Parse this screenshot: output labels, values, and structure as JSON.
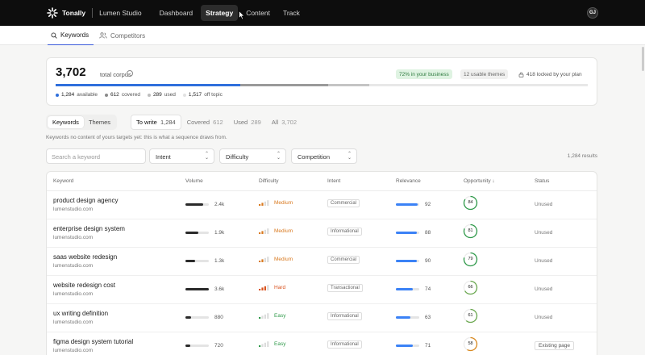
{
  "header": {
    "brand": "Tonally",
    "workspace": "Lumen Studio",
    "nav": [
      {
        "label": "Dashboard",
        "active": false
      },
      {
        "label": "Strategy",
        "active": true
      },
      {
        "label": "Content",
        "active": false
      },
      {
        "label": "Track",
        "active": false
      }
    ],
    "avatar_initials": "GJ"
  },
  "subtabs": [
    {
      "label": "Keywords",
      "icon": "search-icon",
      "active": true
    },
    {
      "label": "Competitors",
      "icon": "users-icon",
      "active": false
    }
  ],
  "corpus": {
    "total": "3,702",
    "total_label": "total corpus",
    "badges": {
      "in_business": "72% in your business",
      "usable_themes": "12 usable themes",
      "locked": "418 locked by your plan"
    },
    "segments": [
      {
        "value": "1,284",
        "label": "available",
        "fraction": 0.347,
        "color": "#2f6fdc"
      },
      {
        "value": "612",
        "label": "covered",
        "fraction": 0.165,
        "color": "#9a9a9a"
      },
      {
        "value": "289",
        "label": "used",
        "fraction": 0.078,
        "color": "#c4c4c4"
      },
      {
        "value": "1,517",
        "label": "off topic",
        "fraction": 0.41,
        "color": "#e8e8e8"
      }
    ]
  },
  "view_toggle": [
    {
      "label": "Keywords",
      "active": true
    },
    {
      "label": "Themes",
      "active": false
    }
  ],
  "status_filter": [
    {
      "label": "To write",
      "count": "1,284",
      "active": true
    },
    {
      "label": "Covered",
      "count": "612",
      "active": false
    },
    {
      "label": "Used",
      "count": "289",
      "active": false
    },
    {
      "label": "All",
      "count": "3,702",
      "active": false
    }
  ],
  "hint": "Keywords no content of yours targets yet: this is what a sequence draws from.",
  "filters": {
    "search_placeholder": "Search a keyword",
    "intent": "Intent",
    "difficulty": "Difficulty",
    "competition": "Competition"
  },
  "results_count": "1,284 results",
  "table": {
    "columns": [
      "Keyword",
      "Volume",
      "Difficulty",
      "Intent",
      "Relevance",
      "Opportunity",
      "Status"
    ],
    "rows": [
      {
        "keyword": "product design agency",
        "domain": "lumenstudio.com",
        "volume": "2.4k",
        "volume_fraction": 0.75,
        "difficulty": "Medium",
        "difficulty_level": 2,
        "intent": "Commercial",
        "relevance": "92",
        "opportunity": "84",
        "status": "Unused",
        "status_tag": false
      },
      {
        "keyword": "enterprise design system",
        "domain": "lumenstudio.com",
        "volume": "1.9k",
        "volume_fraction": 0.55,
        "difficulty": "Medium",
        "difficulty_level": 2,
        "intent": "Informational",
        "relevance": "88",
        "opportunity": "81",
        "status": "Unused",
        "status_tag": false
      },
      {
        "keyword": "saas website redesign",
        "domain": "lumenstudio.com",
        "volume": "1.3k",
        "volume_fraction": 0.4,
        "difficulty": "Medium",
        "difficulty_level": 2,
        "intent": "Commercial",
        "relevance": "90",
        "opportunity": "79",
        "status": "Unused",
        "status_tag": false
      },
      {
        "keyword": "website redesign cost",
        "domain": "lumenstudio.com",
        "volume": "3.6k",
        "volume_fraction": 1.0,
        "difficulty": "Hard",
        "difficulty_level": 3,
        "intent": "Transactional",
        "relevance": "74",
        "opportunity": "66",
        "status": "Unused",
        "status_tag": false
      },
      {
        "keyword": "ux writing definition",
        "domain": "lumenstudio.com",
        "volume": "880",
        "volume_fraction": 0.25,
        "difficulty": "Easy",
        "difficulty_level": 1,
        "intent": "Informational",
        "relevance": "63",
        "opportunity": "61",
        "status": "Unused",
        "status_tag": false
      },
      {
        "keyword": "figma design system tutorial",
        "domain": "lumenstudio.com",
        "volume": "720",
        "volume_fraction": 0.2,
        "difficulty": "Easy",
        "difficulty_level": 1,
        "intent": "Informational",
        "relevance": "71",
        "opportunity": "58",
        "status": "Existing page",
        "status_tag": true
      }
    ]
  },
  "colors": {
    "easy": "#2f9a4a",
    "medium": "#d9791f",
    "hard": "#d9531f",
    "accent": "#3b5bdb",
    "relevance": "#3b82f6"
  }
}
